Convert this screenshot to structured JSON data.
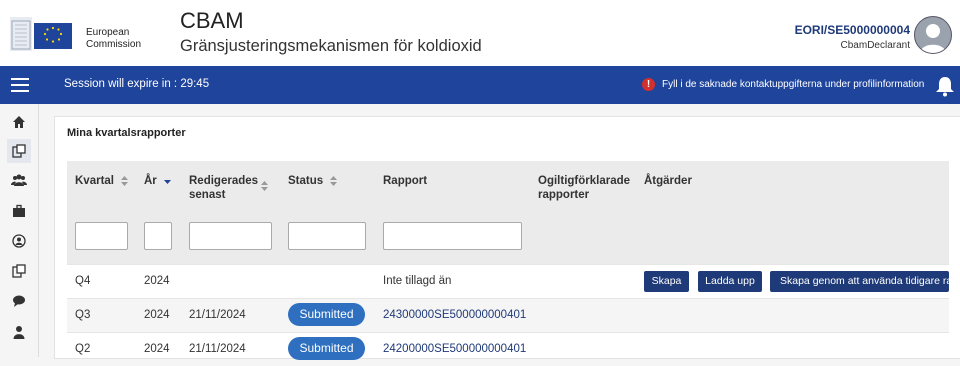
{
  "header": {
    "logo_line1": "European",
    "logo_line2": "Commission",
    "app_title": "CBAM",
    "app_subtitle": "Gränsjusteringsmekanismen för koldioxid",
    "eori": "EORI/SE5000000004",
    "role": "CbamDeclarant"
  },
  "topbar": {
    "session_text": "Session will expire in : 29:45",
    "alert_text": "Fyll i de saknade kontaktuppgifterna under profilinformation"
  },
  "sidebar": {
    "items": [
      "home-icon",
      "reports-icon",
      "users-icon",
      "briefcase-icon",
      "profile-icon",
      "documents-icon",
      "chat-icon",
      "person-icon"
    ]
  },
  "card": {
    "title": "Mina kvartalsrapporter",
    "columns": {
      "kvartal": "Kvartal",
      "ar": "År",
      "redigerades": "Redigerades senast",
      "status": "Status",
      "rapport": "Rapport",
      "ogiltig": "Ogiltigförklarade rapporter",
      "atgarder": "Åtgärder"
    },
    "rows": [
      {
        "kvartal": "Q4",
        "ar": "2024",
        "redigerades": "",
        "status": "",
        "rapport": "Inte tillagd än",
        "actions": [
          "Skapa",
          "Ladda upp",
          "Skapa genom att använda tidigare rapp"
        ]
      },
      {
        "kvartal": "Q3",
        "ar": "2024",
        "redigerades": "21/11/2024",
        "status": "Submitted",
        "rapport": "24300000SE500000000401"
      },
      {
        "kvartal": "Q2",
        "ar": "2024",
        "redigerades": "21/11/2024",
        "status": "Submitted",
        "rapport": "24200000SE500000000401"
      }
    ]
  },
  "colors": {
    "brand_blue": "#1f449c",
    "link_blue": "#1f3a78",
    "badge_blue": "#2e6fc0",
    "alert_red": "#d32f2f"
  }
}
